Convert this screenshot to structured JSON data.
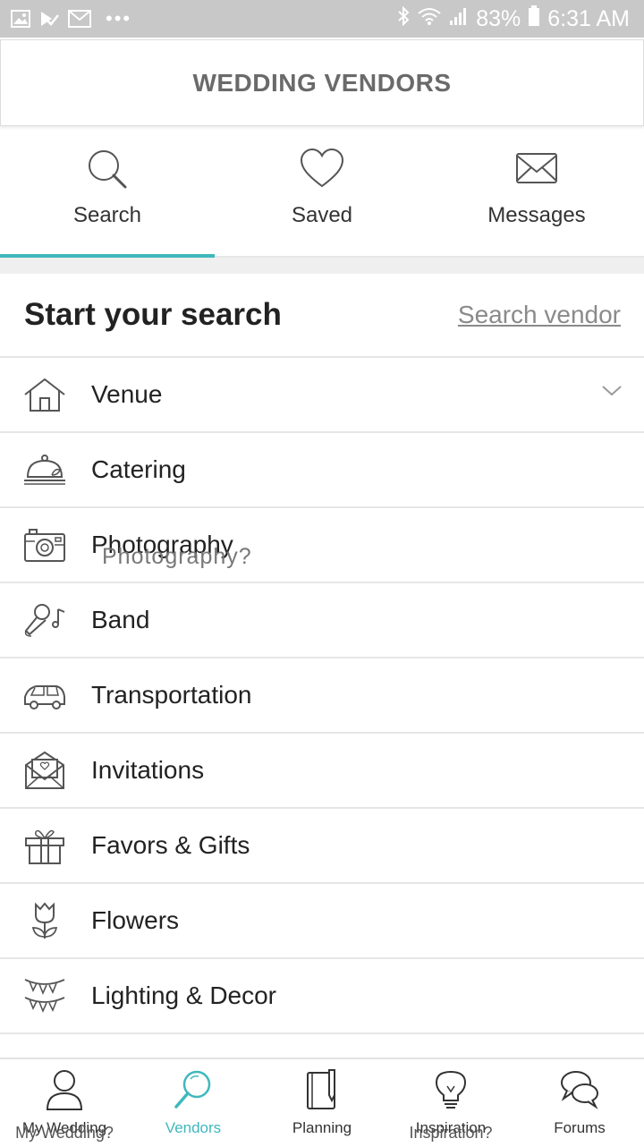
{
  "status_bar": {
    "battery": "83%",
    "time": "6:31 AM",
    "icons": [
      "image-icon",
      "checkmark-icon",
      "mail-icon",
      "more-dots-icon",
      "bluetooth-icon",
      "wifi-icon",
      "signal-icon",
      "battery-icon"
    ]
  },
  "header": {
    "title": "WEDDING VENDORS"
  },
  "tabs": [
    {
      "label": "Search",
      "icon": "search-icon",
      "active": true
    },
    {
      "label": "Saved",
      "icon": "heart-icon",
      "active": false
    },
    {
      "label": "Messages",
      "icon": "envelope-icon",
      "active": false
    }
  ],
  "search": {
    "title": "Start your search",
    "link": "Search vendor"
  },
  "categories": [
    {
      "label": "Venue",
      "icon": "house-icon"
    },
    {
      "label": "Catering",
      "icon": "cloche-icon"
    },
    {
      "label": "Photography",
      "icon": "camera-icon",
      "overlay": "Photography?"
    },
    {
      "label": "Band",
      "icon": "microphone-icon"
    },
    {
      "label": "Transportation",
      "icon": "car-icon"
    },
    {
      "label": "Invitations",
      "icon": "invitation-icon"
    },
    {
      "label": "Favors & Gifts",
      "icon": "gift-icon"
    },
    {
      "label": "Flowers",
      "icon": "tulip-icon"
    },
    {
      "label": "Lighting & Decor",
      "icon": "bunting-icon"
    }
  ],
  "bottom_nav": [
    {
      "label": "My Wedding",
      "icon": "person-icon",
      "ghost": "My Wedding?"
    },
    {
      "label": "Vendors",
      "icon": "magnifier-icon",
      "active": true
    },
    {
      "label": "Planning",
      "icon": "notebook-icon"
    },
    {
      "label": "Inspiration",
      "icon": "lightbulb-icon",
      "ghost": "Inspiration?"
    },
    {
      "label": "Forums",
      "icon": "chat-bubbles-icon"
    }
  ],
  "colors": {
    "accent": "#3fb8bd",
    "status_bar": "#c8c8c8",
    "title": "#6a6a6a"
  }
}
